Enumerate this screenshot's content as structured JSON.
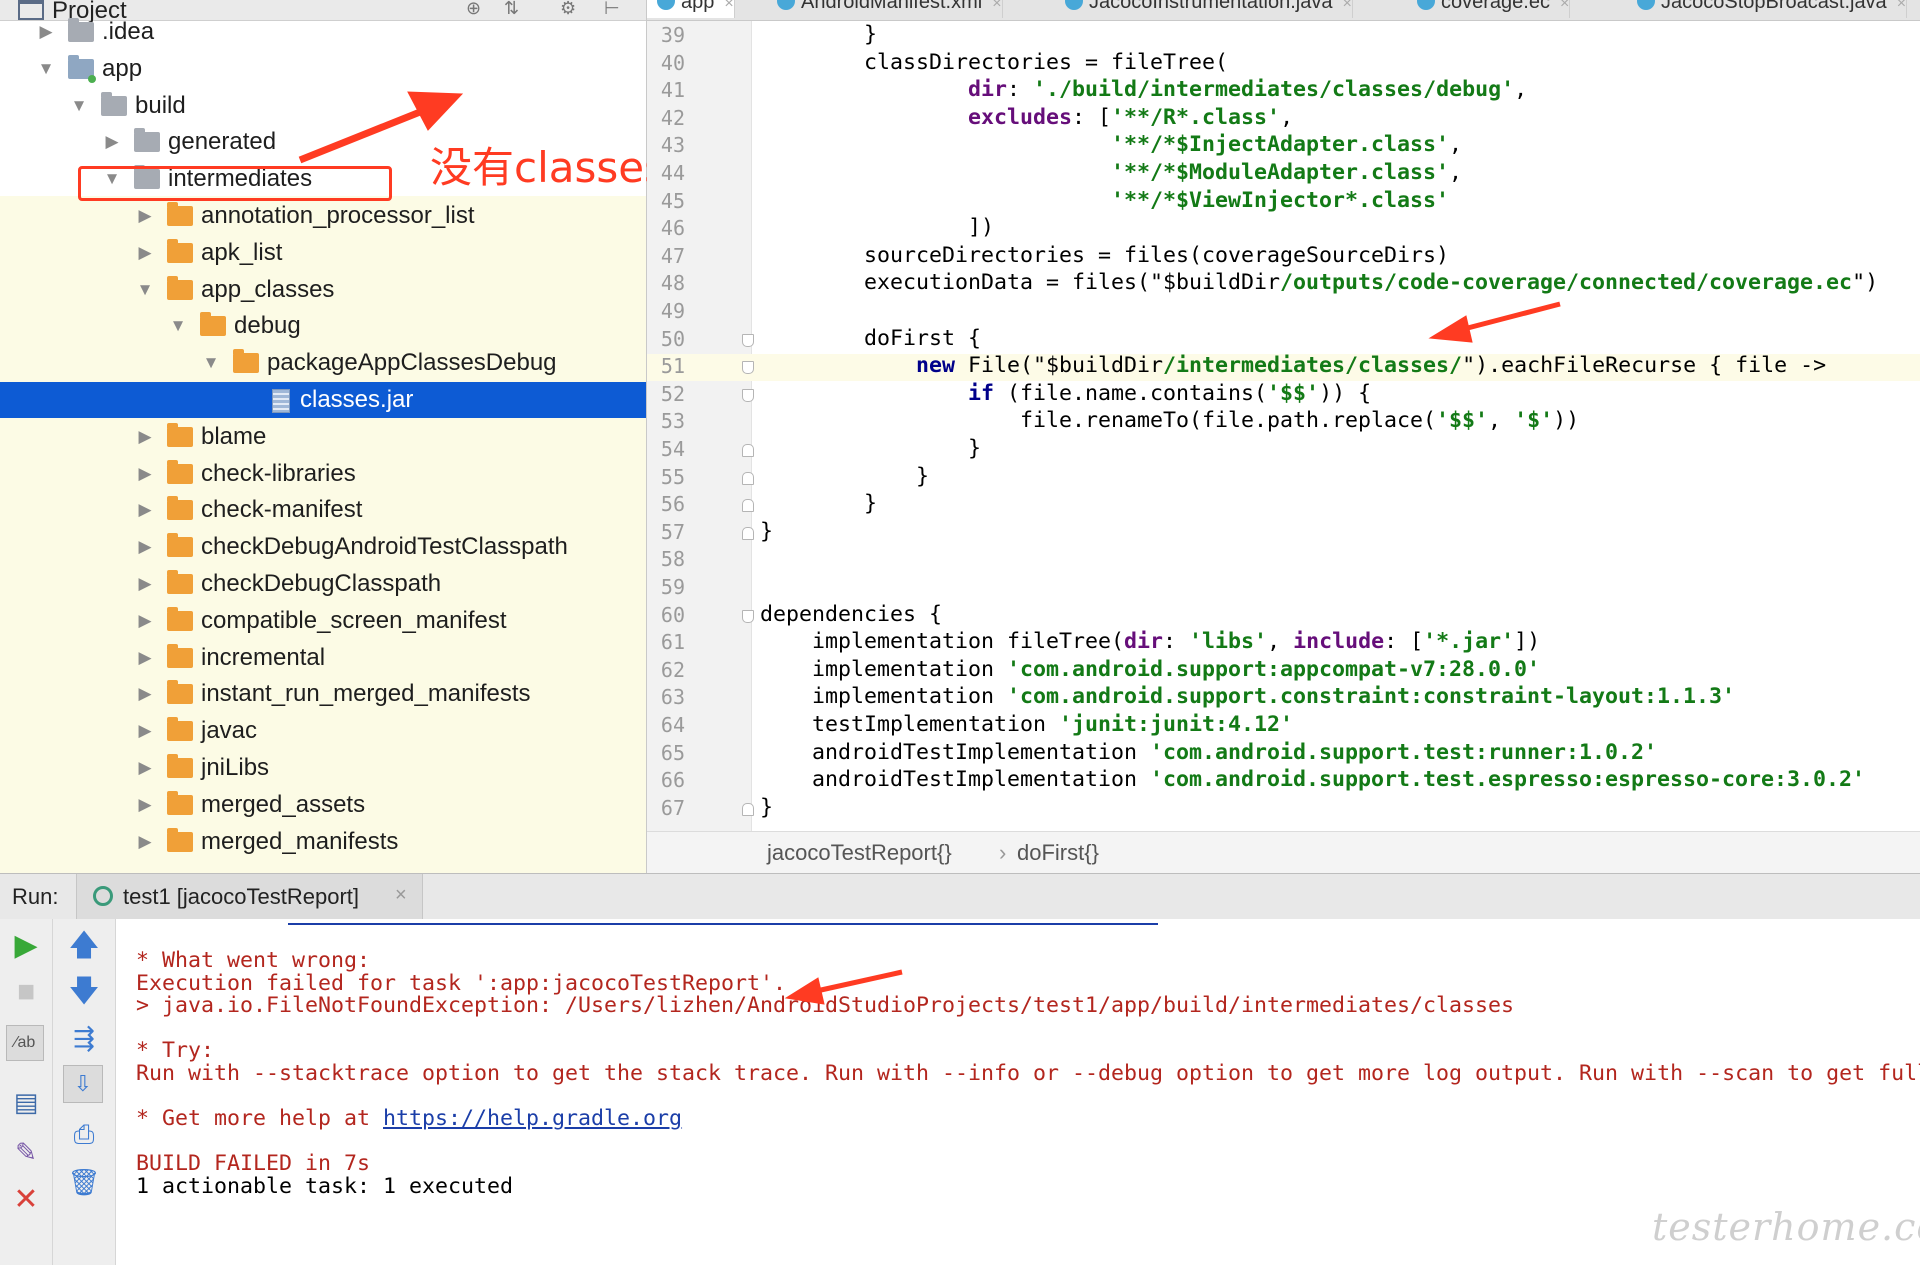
{
  "project": {
    "title": "Project",
    "items": [
      {
        "label": ".idea",
        "depth": 0,
        "expanded": false,
        "icon": "folder-grey"
      },
      {
        "label": "app",
        "depth": 0,
        "expanded": true,
        "icon": "module-folder"
      },
      {
        "label": "build",
        "depth": 1,
        "expanded": true,
        "icon": "folder-grey"
      },
      {
        "label": "generated",
        "depth": 2,
        "expanded": false,
        "icon": "folder-grey"
      },
      {
        "label": "intermediates",
        "depth": 2,
        "expanded": true,
        "icon": "folder-grey"
      },
      {
        "label": "annotation_processor_list",
        "depth": 3,
        "expanded": false,
        "icon": "folder-orange"
      },
      {
        "label": "apk_list",
        "depth": 3,
        "expanded": false,
        "icon": "folder-orange"
      },
      {
        "label": "app_classes",
        "depth": 3,
        "expanded": true,
        "icon": "folder-orange"
      },
      {
        "label": "debug",
        "depth": 4,
        "expanded": true,
        "icon": "folder-orange"
      },
      {
        "label": "packageAppClassesDebug",
        "depth": 5,
        "expanded": true,
        "icon": "folder-orange"
      },
      {
        "label": "classes.jar",
        "depth": 6,
        "expanded": null,
        "icon": "jar-file",
        "selected": true
      },
      {
        "label": "blame",
        "depth": 3,
        "expanded": false,
        "icon": "folder-orange"
      },
      {
        "label": "check-libraries",
        "depth": 3,
        "expanded": false,
        "icon": "folder-orange"
      },
      {
        "label": "check-manifest",
        "depth": 3,
        "expanded": false,
        "icon": "folder-orange"
      },
      {
        "label": "checkDebugAndroidTestClasspath",
        "depth": 3,
        "expanded": false,
        "icon": "folder-orange"
      },
      {
        "label": "checkDebugClasspath",
        "depth": 3,
        "expanded": false,
        "icon": "folder-orange"
      },
      {
        "label": "compatible_screen_manifest",
        "depth": 3,
        "expanded": false,
        "icon": "folder-orange"
      },
      {
        "label": "incremental",
        "depth": 3,
        "expanded": false,
        "icon": "folder-orange"
      },
      {
        "label": "instant_run_merged_manifests",
        "depth": 3,
        "expanded": false,
        "icon": "folder-orange"
      },
      {
        "label": "javac",
        "depth": 3,
        "expanded": false,
        "icon": "folder-orange"
      },
      {
        "label": "jniLibs",
        "depth": 3,
        "expanded": false,
        "icon": "folder-orange"
      },
      {
        "label": "merged_assets",
        "depth": 3,
        "expanded": false,
        "icon": "folder-orange"
      },
      {
        "label": "merged_manifests",
        "depth": 3,
        "expanded": false,
        "icon": "folder-orange"
      }
    ]
  },
  "annotation": {
    "text": "没有classes的package",
    "color": "#ff3b22"
  },
  "tabs": [
    {
      "label": "app",
      "active": true
    },
    {
      "label": "AndroidManifest.xml",
      "active": false
    },
    {
      "label": "JacocoInstrumentation.java",
      "active": false
    },
    {
      "label": "coverage.ec",
      "active": false
    },
    {
      "label": "JacocoStopBroacast.java",
      "active": false
    }
  ],
  "editor": {
    "lines": [
      {
        "n": "39",
        "fold": "",
        "code": [
          [
            "",
            "        }"
          ]
        ]
      },
      {
        "n": "40",
        "fold": "",
        "code": [
          [
            "",
            "        classDirectories = fileTree("
          ]
        ]
      },
      {
        "n": "41",
        "fold": "",
        "code": [
          [
            "",
            "                "
          ],
          [
            "n",
            "dir"
          ],
          [
            "",
            ": "
          ],
          [
            "s",
            "'./build/intermediates/classes/debug'"
          ],
          [
            "",
            ","
          ]
        ]
      },
      {
        "n": "42",
        "fold": "",
        "code": [
          [
            "",
            "                "
          ],
          [
            "n",
            "excludes"
          ],
          [
            "",
            ": ["
          ],
          [
            "s",
            "'**/R*.class'"
          ],
          [
            "",
            ","
          ]
        ]
      },
      {
        "n": "43",
        "fold": "",
        "code": [
          [
            "",
            "                           "
          ],
          [
            "s",
            "'**/*$InjectAdapter.class'"
          ],
          [
            "",
            ","
          ]
        ]
      },
      {
        "n": "44",
        "fold": "",
        "code": [
          [
            "",
            "                           "
          ],
          [
            "s",
            "'**/*$ModuleAdapter.class'"
          ],
          [
            "",
            ","
          ]
        ]
      },
      {
        "n": "45",
        "fold": "",
        "code": [
          [
            "",
            "                           "
          ],
          [
            "s",
            "'**/*$ViewInjector*.class'"
          ]
        ]
      },
      {
        "n": "46",
        "fold": "",
        "code": [
          [
            "",
            "                ])"
          ]
        ]
      },
      {
        "n": "47",
        "fold": "",
        "code": [
          [
            "",
            "        sourceDirectories = files(coverageSourceDirs)"
          ]
        ]
      },
      {
        "n": "48",
        "fold": "",
        "code": [
          [
            "",
            "        executionData = files(\"$buildDir"
          ],
          [
            "s",
            "/outputs/code-coverage/connected/coverage.ec"
          ],
          [
            "",
            "\")"
          ]
        ]
      },
      {
        "n": "49",
        "fold": "",
        "code": [
          [
            "",
            ""
          ]
        ]
      },
      {
        "n": "50",
        "fold": "down",
        "code": [
          [
            "",
            "        doFirst {"
          ]
        ]
      },
      {
        "n": "51",
        "fold": "down",
        "code": [
          [
            "",
            "            "
          ],
          [
            "k",
            "new"
          ],
          [
            "",
            " File(\"$buildDir"
          ],
          [
            "s",
            "/intermediates/classes/"
          ],
          [
            "",
            "\").eachFileRecurse { file ->"
          ]
        ]
      },
      {
        "n": "52",
        "fold": "down",
        "code": [
          [
            "",
            "                "
          ],
          [
            "k",
            "if"
          ],
          [
            "",
            " (file.name.contains("
          ],
          [
            "s",
            "'$$'"
          ],
          [
            "",
            ")) {"
          ]
        ]
      },
      {
        "n": "53",
        "fold": "",
        "code": [
          [
            "",
            "                    file.renameTo(file.path.replace("
          ],
          [
            "s",
            "'$$'"
          ],
          [
            "",
            ", "
          ],
          [
            "s",
            "'$'"
          ],
          [
            "",
            "))"
          ]
        ]
      },
      {
        "n": "54",
        "fold": "up",
        "code": [
          [
            "",
            "                }"
          ]
        ]
      },
      {
        "n": "55",
        "fold": "up",
        "code": [
          [
            "",
            "            }"
          ]
        ]
      },
      {
        "n": "56",
        "fold": "up",
        "code": [
          [
            "",
            "        }"
          ]
        ]
      },
      {
        "n": "57",
        "fold": "up",
        "code": [
          [
            "",
            "}"
          ]
        ]
      },
      {
        "n": "58",
        "fold": "",
        "code": [
          [
            "",
            ""
          ]
        ]
      },
      {
        "n": "59",
        "fold": "",
        "code": [
          [
            "",
            ""
          ]
        ]
      },
      {
        "n": "60",
        "fold": "down",
        "code": [
          [
            "",
            "dependencies {"
          ]
        ]
      },
      {
        "n": "61",
        "fold": "",
        "code": [
          [
            "",
            "    implementation fileTree("
          ],
          [
            "n",
            "dir"
          ],
          [
            "",
            ": "
          ],
          [
            "s",
            "'libs'"
          ],
          [
            "",
            ", "
          ],
          [
            "n",
            "include"
          ],
          [
            "",
            ": ["
          ],
          [
            "s",
            "'*.jar'"
          ],
          [
            "",
            "])"
          ]
        ]
      },
      {
        "n": "62",
        "fold": "",
        "code": [
          [
            "",
            "    implementation "
          ],
          [
            "s",
            "'com.android.support:appcompat-v7:28.0.0'"
          ]
        ]
      },
      {
        "n": "63",
        "fold": "",
        "code": [
          [
            "",
            "    implementation "
          ],
          [
            "s",
            "'com.android.support.constraint:constraint-layout:1.1.3'"
          ]
        ]
      },
      {
        "n": "64",
        "fold": "",
        "code": [
          [
            "",
            "    testImplementation "
          ],
          [
            "s",
            "'junit:junit:4.12'"
          ]
        ]
      },
      {
        "n": "65",
        "fold": "",
        "code": [
          [
            "",
            "    androidTestImplementation "
          ],
          [
            "s",
            "'com.android.support.test:runner:1.0.2'"
          ]
        ]
      },
      {
        "n": "66",
        "fold": "",
        "code": [
          [
            "",
            "    androidTestImplementation "
          ],
          [
            "s",
            "'com.android.support.test.espresso:espresso-core:3.0.2'"
          ]
        ]
      },
      {
        "n": "67",
        "fold": "up",
        "code": [
          [
            "",
            "}"
          ]
        ]
      }
    ]
  },
  "breadcrumb": {
    "first": "jacocoTestReport{}",
    "separator": "›",
    "second": "doFirst{}"
  },
  "run": {
    "label": "Run:",
    "tab_label": "test1 [jacocoTestReport]",
    "console": [
      {
        "kind": "err",
        "text": "* What went wrong:"
      },
      {
        "kind": "err",
        "text": "Execution failed for task ':app:jacocoTestReport'."
      },
      {
        "kind": "err",
        "text": "> java.io.FileNotFoundException: /Users/lizhen/AndroidStudioProjects/test1/app/build/intermediates/classes"
      },
      {
        "kind": "blank",
        "text": ""
      },
      {
        "kind": "err",
        "text": "* Try:"
      },
      {
        "kind": "err",
        "text": "Run with --stacktrace option to get the stack trace. Run with --info or --debug option to get more log output. Run with --scan to get full"
      },
      {
        "kind": "blank",
        "text": ""
      },
      {
        "kind": "err-link",
        "text": "* Get more help at ",
        "link": "https://help.gradle.org"
      },
      {
        "kind": "blank",
        "text": ""
      },
      {
        "kind": "err",
        "text": "BUILD FAILED in 7s"
      },
      {
        "kind": "plain",
        "text": "1 actionable task: 1 executed"
      }
    ]
  },
  "watermark": "testerhome.com",
  "colors": {
    "accent": "#0d5bd4",
    "annotation": "#ff3b22",
    "error": "#b3261e",
    "string": "#137a16"
  }
}
